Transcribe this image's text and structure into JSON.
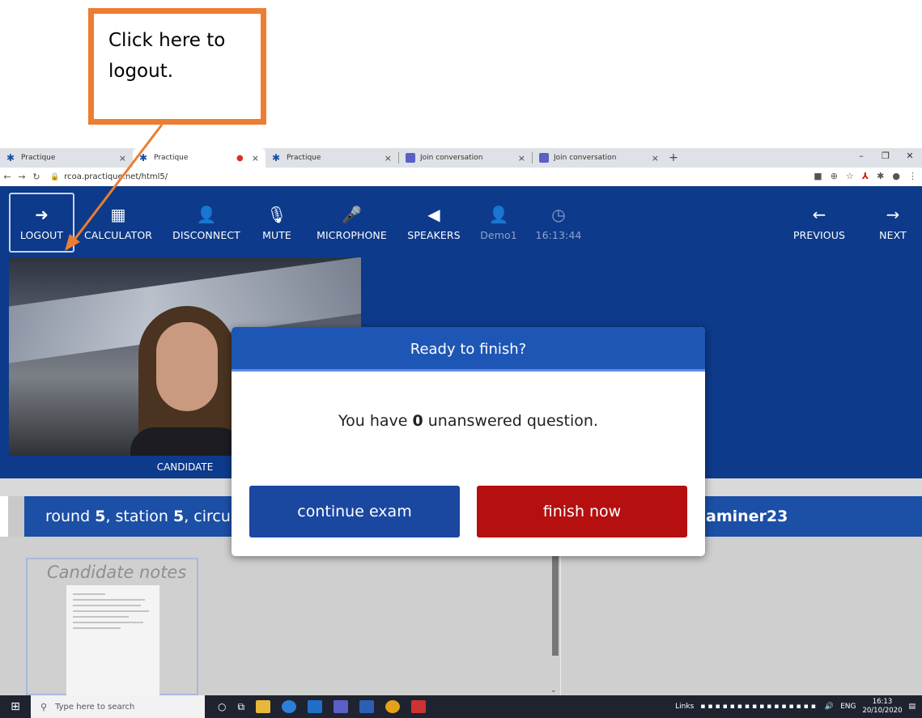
{
  "callout": {
    "line1": "Click here to",
    "line2": "logout.",
    "color": "#ed7d31"
  },
  "browser": {
    "tabs": [
      {
        "title": "Practique",
        "icon": "practique-star-icon",
        "active": false
      },
      {
        "title": "Practique",
        "icon": "practique-star-icon",
        "active": true,
        "recording": true
      },
      {
        "title": "Practique",
        "icon": "practique-star-icon",
        "active": false
      },
      {
        "title": "Join conversation",
        "icon": "teams-icon",
        "active": false
      },
      {
        "title": "Join conversation",
        "icon": "teams-icon",
        "active": false
      }
    ],
    "url": "rcoa.practique.net/html5/"
  },
  "toolbar": {
    "logout": "LOGOUT",
    "calculator": "CALCULATOR",
    "disconnect": "DISCONNECT",
    "mute": "MUTE",
    "microphone": "MICROPHONE",
    "speakers": "SPEAKERS",
    "user": "Demo1",
    "clock": "16:13:44",
    "previous": "PREVIOUS",
    "next": "NEXT",
    "bg_color": "#0d3a8a"
  },
  "video": {
    "caption": "CANDIDATE"
  },
  "info_bar": {
    "round_label": "round ",
    "round": "5",
    "station_label": ", station ",
    "station": "5",
    "circuit_label": ", circu",
    "examiner_fragment": "aminer23"
  },
  "notes": {
    "title": "Candidate notes"
  },
  "modal": {
    "title": "Ready to finish?",
    "text_before": "You have ",
    "count": "0",
    "text_after": " unanswered question.",
    "continue_label": "continue exam",
    "finish_label": "finish now",
    "header_color": "#1e56b6",
    "continue_color": "#1a47a0",
    "finish_color": "#b50f0f"
  },
  "taskbar": {
    "search_placeholder": "Type here to search",
    "links": "Links",
    "lang": "ENG",
    "time": "16:13",
    "date": "20/10/2020"
  }
}
